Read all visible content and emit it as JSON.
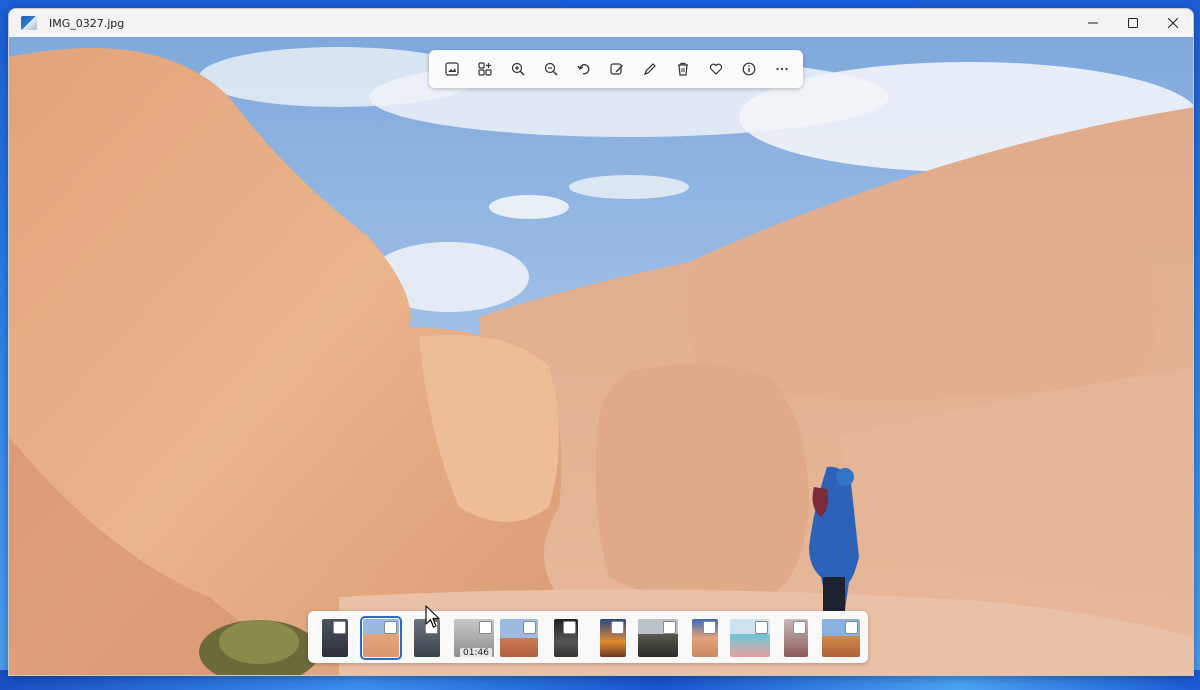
{
  "window": {
    "title": "IMG_0327.jpg",
    "controls": [
      "minimize-icon",
      "maximize-icon",
      "close-icon"
    ]
  },
  "toolbar": {
    "buttons": [
      {
        "name": "view-actual-size",
        "icon": "image-frame-icon"
      },
      {
        "name": "add-to-album",
        "icon": "collection-add-icon"
      },
      {
        "name": "zoom-in",
        "icon": "zoom-in-icon"
      },
      {
        "name": "zoom-out",
        "icon": "zoom-out-icon"
      },
      {
        "name": "rotate",
        "icon": "rotate-icon"
      },
      {
        "name": "edit-image",
        "icon": "edit-image-icon"
      },
      {
        "name": "draw",
        "icon": "pencil-icon"
      },
      {
        "name": "delete",
        "icon": "trash-icon"
      },
      {
        "name": "favorite",
        "icon": "heart-icon"
      },
      {
        "name": "file-info",
        "icon": "info-icon"
      },
      {
        "name": "see-more",
        "icon": "more-horizontal-icon"
      }
    ]
  },
  "filmstrip": {
    "thumbnails": [
      {
        "selected": false
      },
      {
        "selected": true
      },
      {
        "selected": false
      },
      {
        "selected": false,
        "duration": "01:46"
      },
      {
        "selected": false
      },
      {
        "selected": false
      },
      {
        "selected": false
      },
      {
        "selected": false
      },
      {
        "selected": false
      },
      {
        "selected": false
      },
      {
        "selected": false
      },
      {
        "selected": false
      }
    ]
  },
  "colors": {
    "accent": "#2b6cc4",
    "sky": "#8fb6e4",
    "rock": "#e4a97e"
  }
}
